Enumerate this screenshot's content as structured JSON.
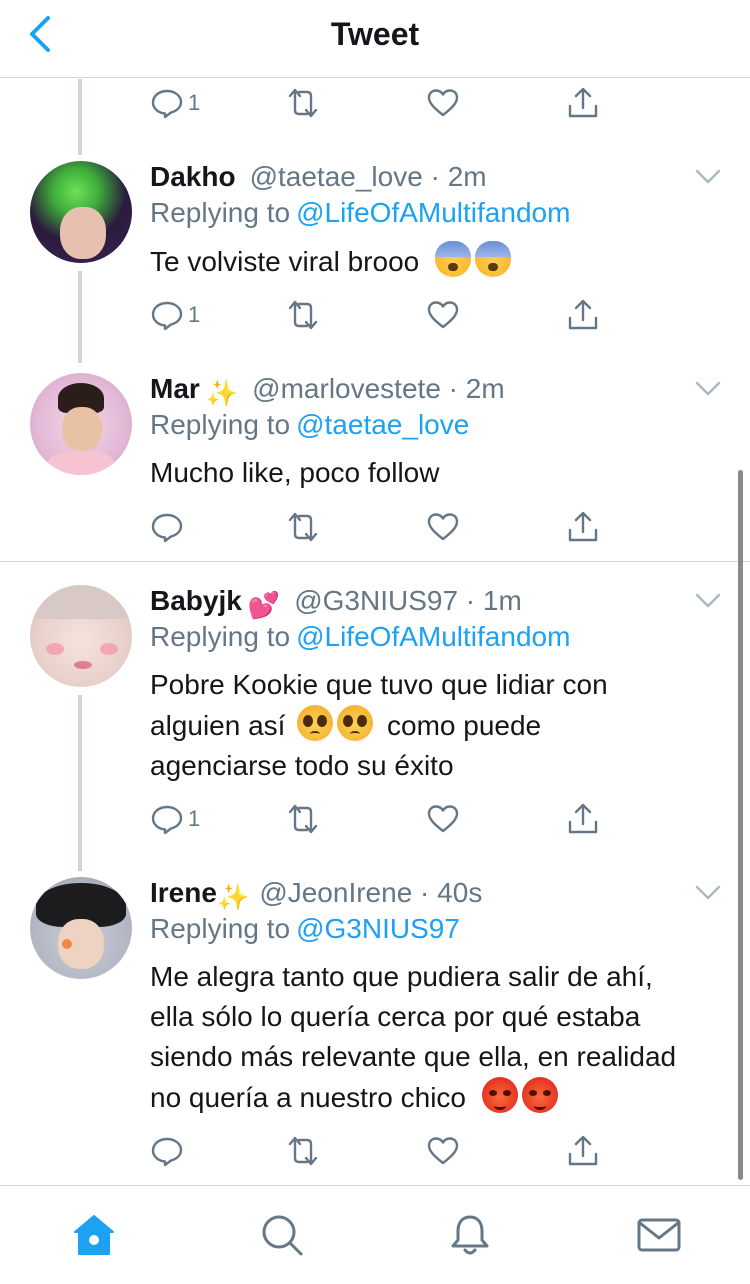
{
  "header": {
    "title": "Tweet"
  },
  "top_actions": {
    "reply_count": "1"
  },
  "tweets": [
    {
      "name": "Dakho",
      "name_emoji": "",
      "handle": "@taetae_love",
      "time": "2m",
      "reply_prefix": "Replying to",
      "reply_to": "@LifeOfAMultifandom",
      "lines": [
        "Te volviste viral brooo"
      ],
      "text_emojis": [
        "fearful-face",
        "fearful-face"
      ],
      "reply_count": "1"
    },
    {
      "name": "Mar",
      "name_emoji": "sparkles",
      "handle": "@marlovestete",
      "time": "2m",
      "reply_prefix": "Replying to",
      "reply_to": "@taetae_love",
      "lines": [
        "Mucho like, poco follow"
      ],
      "reply_count": ""
    },
    {
      "name": "Babyjk",
      "name_emoji": "two-hearts",
      "handle": "@G3NIUS97",
      "time": "1m",
      "reply_prefix": "Replying to",
      "reply_to": "@LifeOfAMultifandom",
      "lines": [
        "Pobre Kookie que tuvo que lidiar con",
        "alguien así",
        "como puede",
        "agenciarse todo su éxito"
      ],
      "reply_count": "1"
    },
    {
      "name": "Irene",
      "name_emoji": "sparkles",
      "handle": "@JeonIrene",
      "time": "40s",
      "reply_prefix": "Replying to",
      "reply_to": "@G3NIUS97",
      "lines": [
        "Me alegra tanto que pudiera salir de ahí,",
        "ella sólo lo quería cerca por qué estaba",
        "siendo más relevante que ella, en realidad",
        "no quería a nuestro chico"
      ],
      "reply_count": ""
    }
  ],
  "tabs": [
    "home-icon",
    "search-icon",
    "notifications-bell-icon",
    "messages-envelope-icon"
  ],
  "colors": {
    "accent": "#1da1f2",
    "secondary_text": "#657786",
    "border": "#cfd5db"
  }
}
